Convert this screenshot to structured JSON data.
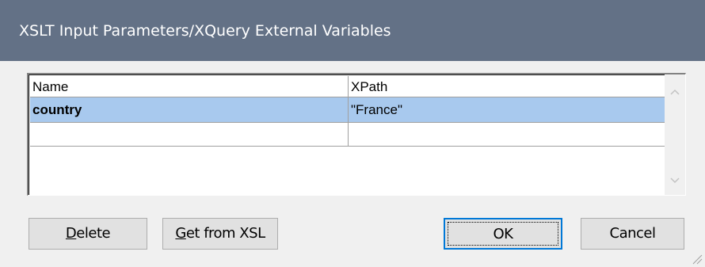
{
  "dialog": {
    "title": "XSLT Input Parameters/XQuery External Variables"
  },
  "table": {
    "columns": [
      "Name",
      "XPath"
    ],
    "rows": [
      {
        "name": "country",
        "xpath": "\"France\"",
        "selected": true
      },
      {
        "name": "",
        "xpath": "",
        "selected": false
      }
    ]
  },
  "buttons": {
    "delete": {
      "label": "Delete",
      "accel": "D"
    },
    "get_from_xsl": {
      "label": "Get from XSL",
      "accel": "G"
    },
    "ok": {
      "label": "OK"
    },
    "cancel": {
      "label": "Cancel"
    }
  },
  "colors": {
    "titlebar": "#637186",
    "selection": "#a8c9ee",
    "focus_border": "#0078d7"
  }
}
